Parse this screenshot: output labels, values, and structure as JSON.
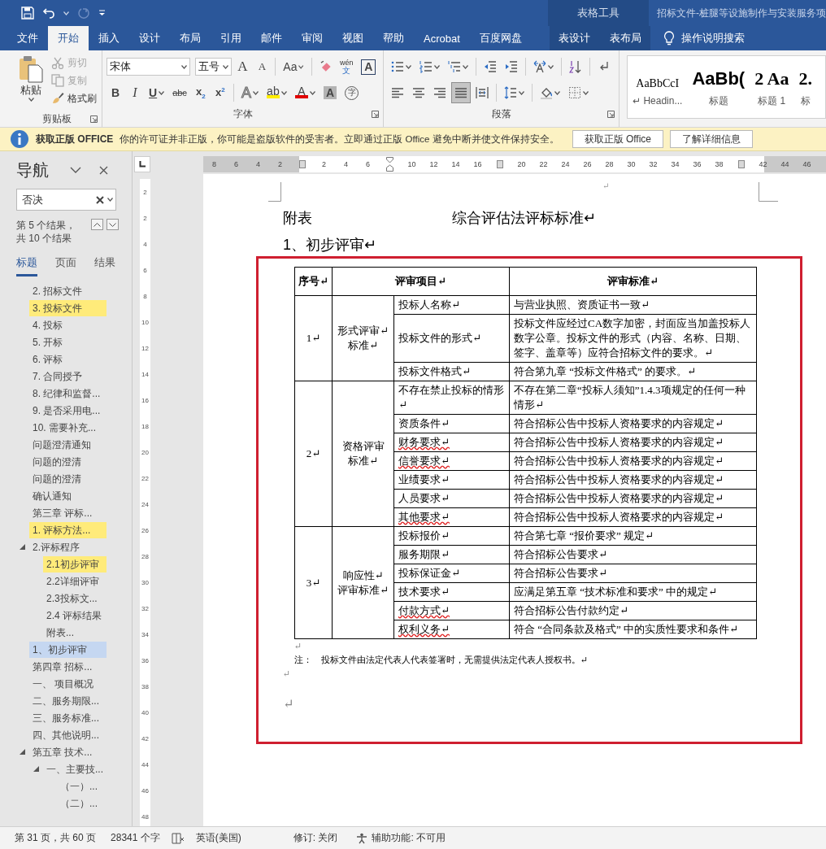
{
  "title_bar": {
    "context_label": "表格工具",
    "document_title": "招标文件-桩腿等设施制作与安装服务项"
  },
  "tabs": [
    {
      "label": "文件",
      "selected": false
    },
    {
      "label": "开始",
      "selected": true
    },
    {
      "label": "插入",
      "selected": false
    },
    {
      "label": "设计",
      "selected": false
    },
    {
      "label": "布局",
      "selected": false
    },
    {
      "label": "引用",
      "selected": false
    },
    {
      "label": "邮件",
      "selected": false
    },
    {
      "label": "审阅",
      "selected": false
    },
    {
      "label": "视图",
      "selected": false
    },
    {
      "label": "帮助",
      "selected": false
    },
    {
      "label": "Acrobat",
      "selected": false
    },
    {
      "label": "百度网盘",
      "selected": false
    }
  ],
  "contextual_tabs": [
    {
      "label": "表设计",
      "selected": false
    },
    {
      "label": "表布局",
      "selected": false
    }
  ],
  "tell_me": "操作说明搜索",
  "ribbon": {
    "clipboard": {
      "paste": "粘贴",
      "group_label": "剪贴板",
      "items": [
        {
          "kind": "cut",
          "label": "剪切",
          "disabled": true
        },
        {
          "kind": "copy",
          "label": "复制",
          "disabled": true
        },
        {
          "kind": "brush",
          "label": "格式刷",
          "disabled": false
        }
      ]
    },
    "font": {
      "group_label": "字体",
      "font_name": "宋体",
      "font_size": "五号",
      "row1": [
        {
          "kind": "grow",
          "glyph": "A"
        },
        {
          "kind": "shrink",
          "glyph": "A"
        },
        {
          "kind": "case",
          "glyph": "Aa",
          "caret": true
        },
        {
          "kind": "clear"
        },
        {
          "kind": "phonetic",
          "glyph": "wén",
          "sub_glyph": "文"
        },
        {
          "kind": "border",
          "glyph": "A"
        }
      ],
      "row2": [
        {
          "kind": "bold",
          "glyph": "B"
        },
        {
          "kind": "italic",
          "glyph": "I"
        },
        {
          "kind": "underline",
          "glyph": "U",
          "caret": true
        },
        {
          "kind": "strike",
          "glyph": "abc"
        },
        {
          "kind": "script",
          "glyph": "x$_{2}$"
        },
        {
          "kind": "script",
          "glyph": "x$^{2}$"
        },
        {
          "kind": "effect",
          "glyph": "A",
          "caret": true
        },
        {
          "kind": "highlight",
          "glyph": "ab",
          "caret": true
        },
        {
          "kind": "fontcolor",
          "glyph": "A",
          "caret": true
        },
        {
          "kind": "shading",
          "glyph": "A"
        },
        {
          "kind": "enclose",
          "glyph": "字"
        }
      ]
    },
    "paragraph": {
      "group_label": "段落",
      "row1": [
        {
          "kind": "bullets",
          "caret": true
        },
        {
          "kind": "numbering",
          "caret": true
        },
        {
          "kind": "multilevel",
          "caret": true
        },
        {
          "kind": "outdent"
        },
        {
          "kind": "indent"
        },
        {
          "kind": "asian-layout",
          "caret": true
        },
        {
          "kind": "sort"
        },
        {
          "kind": "marks"
        }
      ],
      "row2": [
        {
          "kind": "align-left",
          "selected": false
        },
        {
          "kind": "align-center",
          "selected": false
        },
        {
          "kind": "align-right",
          "selected": false
        },
        {
          "kind": "justify",
          "selected": true
        },
        {
          "kind": "distribute",
          "selected": false
        },
        {
          "kind": "line-spacing",
          "caret": true,
          "selected": false
        },
        {
          "kind": "shading-fill",
          "caret": true,
          "selected": false
        },
        {
          "kind": "borders",
          "caret": true,
          "selected": false
        }
      ]
    },
    "styles": [
      {
        "kind": "serif",
        "preview": "AaBbCcI",
        "label": "↵ Headin..."
      },
      {
        "kind": "title",
        "preview": "AaBb(",
        "label": "标题"
      },
      {
        "kind": "heading",
        "preview": "2 Aa",
        "label": "标题 1"
      },
      {
        "kind": "heading",
        "preview": "2.",
        "label": "标"
      }
    ]
  },
  "message_bar": {
    "title": "获取正版 OFFICE",
    "text": "你的许可证并非正版，你可能是盗版软件的受害者。立即通过正版 Office 避免中断并使文件保持安全。",
    "buttons": [
      "获取正版 Office",
      "了解详细信息"
    ]
  },
  "navigation": {
    "title": "导航",
    "search": {
      "value": "否决"
    },
    "result_count": [
      "第 5 个结果，",
      "共 10 个结果"
    ],
    "tabs": [
      {
        "label": "标题",
        "selected": true
      },
      {
        "label": "页面",
        "selected": false
      },
      {
        "label": "结果",
        "selected": false
      }
    ],
    "headings": [
      {
        "text": "2. 招标文件",
        "match": false,
        "selected": false
      },
      {
        "text": "3. 投标文件",
        "match": true,
        "selected": false
      },
      {
        "text": "4. 投标",
        "match": false,
        "selected": false
      },
      {
        "text": "5. 开标",
        "match": false,
        "selected": false
      },
      {
        "text": "6. 评标",
        "match": false,
        "selected": false
      },
      {
        "text": "7. 合同授予",
        "match": false,
        "selected": false
      },
      {
        "text": "8. 纪律和监督...",
        "match": false,
        "selected": false
      },
      {
        "text": "9. 是否采用电...",
        "match": false,
        "selected": false
      },
      {
        "text": "10. 需要补充...",
        "match": false,
        "selected": false
      },
      {
        "text": "问题澄清通知",
        "match": false,
        "selected": false
      },
      {
        "text": "问题的澄清",
        "match": false,
        "selected": false
      },
      {
        "text": "问题的澄清",
        "match": false,
        "selected": false
      },
      {
        "text": "确认通知",
        "match": false,
        "selected": false
      },
      {
        "text": "第三章  评标...",
        "match": false,
        "selected": false
      },
      {
        "text": "1. 评标方法...",
        "match": true,
        "selected": false
      },
      {
        "text": "2.评标程序",
        "match": false,
        "selected": false,
        "expanded": true,
        "children": [
          {
            "text": "2.1初步评审",
            "match": true,
            "selected": false
          },
          {
            "text": "2.2详细评审",
            "match": false,
            "selected": false
          },
          {
            "text": "2.3投标文...",
            "match": false,
            "selected": false
          },
          {
            "text": "2.4 评标结果",
            "match": false,
            "selected": false
          },
          {
            "text": "附表...",
            "match": false,
            "selected": false
          }
        ]
      },
      {
        "text": "1、初步评审",
        "match": false,
        "selected": true
      },
      {
        "text": "第四章  招标...",
        "match": false,
        "selected": false
      },
      {
        "text": "一、 项目概况",
        "match": false,
        "selected": false
      },
      {
        "text": "二、服务期限...",
        "match": false,
        "selected": false
      },
      {
        "text": "三、服务标准...",
        "match": false,
        "selected": false
      },
      {
        "text": "四、其他说明...",
        "match": false,
        "selected": false
      },
      {
        "text": "第五章  技术...",
        "match": false,
        "selected": false,
        "expanded": true,
        "children": [
          {
            "text": "一、主要技...",
            "match": false,
            "selected": false,
            "expanded": true,
            "children": [
              {
                "text": "（一）...",
                "match": false,
                "selected": false
              },
              {
                "text": "（二）...",
                "match": false,
                "selected": false
              }
            ]
          }
        ]
      }
    ]
  },
  "horizontal_ruler": [
    {
      "label": "8"
    },
    {
      "label": "6"
    },
    {
      "label": "4"
    },
    {
      "label": "2"
    },
    {
      "kind": "marker"
    },
    {
      "label": "2"
    },
    {
      "label": "4"
    },
    {
      "label": "6"
    },
    {
      "kind": "indent"
    },
    {
      "label": "10"
    },
    {
      "label": "12"
    },
    {
      "label": "14"
    },
    {
      "label": "16"
    },
    {
      "kind": "marker"
    },
    {
      "label": "20"
    },
    {
      "label": "22"
    },
    {
      "label": "24"
    },
    {
      "label": "26"
    },
    {
      "label": "28"
    },
    {
      "label": "30"
    },
    {
      "label": "32"
    },
    {
      "label": "34"
    },
    {
      "label": "36"
    },
    {
      "label": "38"
    },
    {
      "kind": "marker"
    },
    {
      "label": "42"
    },
    {
      "label": "44"
    },
    {
      "label": "46"
    }
  ],
  "vertical_ruler": [
    "2",
    "2",
    "4",
    "6",
    "8",
    "10",
    "12",
    "14",
    "16",
    "18",
    "20",
    "22",
    "24",
    "26",
    "28",
    "30",
    "32",
    "34",
    "36",
    "38",
    "40",
    "42",
    "44",
    "46",
    "48"
  ],
  "document": {
    "top_mark": "↵",
    "label": "附表",
    "title": "综合评估法评标标准↵",
    "heading": "1、初步评审↵",
    "annotation_frame": true,
    "table": {
      "columns": [
        "序号↵",
        "评审项目↵",
        "评审标准↵"
      ],
      "groups": [
        {
          "number": "1↵",
          "category": [
            "形式评审↵",
            "标准↵"
          ],
          "items": [
            {
              "item": "投标人名称↵",
              "standard": "与营业执照、资质证书一致↵",
              "spelling_error": false
            },
            {
              "item": "投标文件的形式↵",
              "standard": "投标文件应经过CA数字加密，封面应当加盖投标人数字公章。投标文件的形式（内容、名称、日期、签字、盖章等）应符合招标文件的要求。↵",
              "spelling_error": false
            },
            {
              "item": "投标文件格式↵",
              "standard": "符合第九章 “投标文件格式” 的要求。↵",
              "spelling_error": false
            }
          ]
        },
        {
          "number": "2↵",
          "category": [
            "资格评审",
            "标准↵"
          ],
          "items": [
            {
              "item": "不存在禁止投标的情形↵",
              "standard": "不存在第二章“投标人须知”1.4.3项规定的任何一种情形↵",
              "spelling_error": false
            },
            {
              "item": "资质条件↵",
              "standard": "符合招标公告中投标人资格要求的内容规定↵",
              "spelling_error": false
            },
            {
              "item": "财务要求↵",
              "standard": "符合招标公告中投标人资格要求的内容规定↵",
              "spelling_error": true
            },
            {
              "item": "信誉要求↵",
              "standard": "符合招标公告中投标人资格要求的内容规定↵",
              "spelling_error": true
            },
            {
              "item": "业绩要求↵",
              "standard": "符合招标公告中投标人资格要求的内容规定↵",
              "spelling_error": false
            },
            {
              "item": "人员要求↵",
              "standard": "符合招标公告中投标人资格要求的内容规定↵",
              "spelling_error": false
            },
            {
              "item": "其他要求↵",
              "standard": "符合招标公告中投标人资格要求的内容规定↵",
              "spelling_error": true
            }
          ]
        },
        {
          "number": "3↵",
          "category": [
            "响应性↵",
            "评审标准↵"
          ],
          "items": [
            {
              "item": "投标报价↵",
              "standard": "符合第七章 “报价要求” 规定↵",
              "spelling_error": false
            },
            {
              "item": "服务期限↵",
              "standard": "符合招标公告要求↵",
              "spelling_error": false
            },
            {
              "item": "投标保证金↵",
              "standard": "符合招标公告要求↵",
              "spelling_error": false
            },
            {
              "item": "技术要求↵",
              "standard": "应满足第五章 “技术标准和要求” 中的规定↵",
              "spelling_error": false
            },
            {
              "item": "付款方式↵",
              "standard": "符合招标公告付款约定↵",
              "spelling_error": true
            },
            {
              "item": "权利义务↵",
              "standard": "符合 “合同条款及格式” 中的实质性要求和条件↵",
              "spelling_error": true
            }
          ]
        }
      ]
    },
    "after_table": [
      "↵",
      "注：    投标文件由法定代表人代表签署时，无需提供法定代表人授权书。↵",
      "↵",
      "↵"
    ]
  },
  "status_bar": {
    "page": "第 31 页，共 60 页",
    "words": "28341 个字",
    "language": "英语(美国)",
    "track_changes": "修订: 关闭",
    "accessibility": "辅助功能: 不可用"
  }
}
